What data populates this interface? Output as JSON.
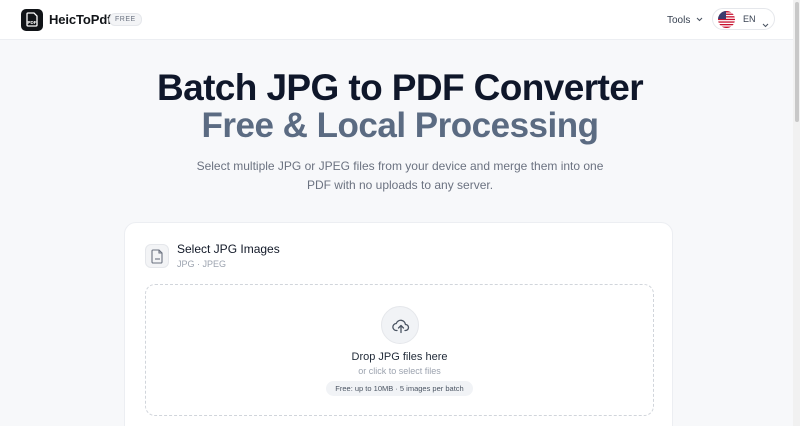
{
  "header": {
    "brand": "HeicToPdf",
    "logo_text": "PDF",
    "free_tag": "FREE",
    "tools_label": "Tools",
    "language": "EN"
  },
  "hero": {
    "title": "Batch JPG to PDF Converter",
    "subtitle": "Free & Local Processing",
    "description": "Select multiple JPG or JPEG files from your device and merge them into one PDF with no uploads to any server."
  },
  "uploader": {
    "title": "Select JPG Images",
    "formats": "JPG · JPEG",
    "drop_text": "Drop JPG files here",
    "drop_sub": "or click to select files",
    "limit": "Free: up to 10MB · 5 images per batch"
  },
  "colors": {
    "accent_dark": "#0f172a",
    "subtitle": "#5b6b82",
    "background": "#f7f8fa"
  },
  "icons": {
    "logo": "pdf-file-icon",
    "uploader": "pdf-file-icon",
    "drop": "cloud-upload-icon",
    "language": "us-flag-icon"
  }
}
